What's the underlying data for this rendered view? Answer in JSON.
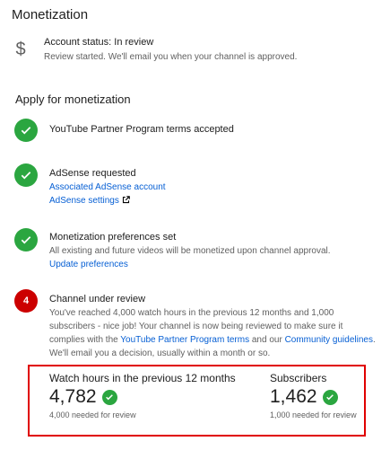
{
  "page": {
    "title": "Monetization"
  },
  "account_status": {
    "icon": "dollar-icon",
    "title": "Account status: In review",
    "subtitle": "Review started. We'll email you when your channel is approved."
  },
  "apply": {
    "title": "Apply for monetization",
    "steps": [
      {
        "state": "done",
        "title": "YouTube Partner Program terms accepted"
      },
      {
        "state": "done",
        "title": "AdSense requested",
        "link_1": "Associated AdSense account",
        "link_2": "AdSense settings"
      },
      {
        "state": "done",
        "title": "Monetization preferences set",
        "desc": "All existing and future videos will be monetized upon channel approval.",
        "link": "Update preferences"
      },
      {
        "state": "pending",
        "number": "4",
        "title": "Channel under review",
        "line_1": "You've reached 4,000 watch hours in the previous 12 months and 1,000",
        "line_2": "subscribers - nice job! Your channel is now being reviewed to make sure it",
        "line_3_prefix": "complies with the ",
        "line_3_link_1": "YouTube Partner Program terms",
        "line_3_middle": " and our ",
        "line_3_link_2": "Community guidelines",
        "line_3_suffix": ".",
        "line_4": "We'll email you a decision, usually within a month or so."
      }
    ]
  },
  "stats": {
    "watch_hours": {
      "label": "Watch hours in the previous 12 months",
      "value": "4,782",
      "note": "4,000 needed for review"
    },
    "subscribers": {
      "label": "Subscribers",
      "value": "1,462",
      "note": "1,000 needed for review"
    }
  },
  "colors": {
    "check_green": "#2ba640",
    "step_red": "#cc0000",
    "link_blue": "#065fd4",
    "highlight_border": "#e00000"
  }
}
